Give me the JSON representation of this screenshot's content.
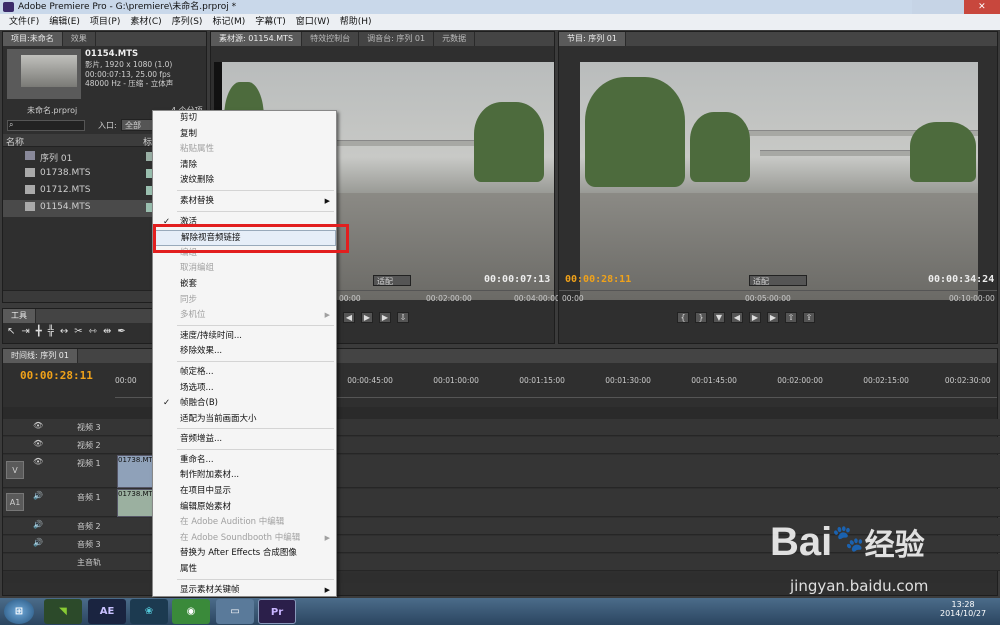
{
  "window": {
    "title": "Adobe Premiere Pro - G:\\premiere\\未命名.prproj *"
  },
  "menubar": [
    "文件(F)",
    "编辑(E)",
    "项目(P)",
    "素材(C)",
    "序列(S)",
    "标记(M)",
    "字幕(T)",
    "窗口(W)",
    "帮助(H)"
  ],
  "project": {
    "tabs": [
      "项目:未命名",
      "效果"
    ],
    "clip_name": "01154.MTS",
    "clip_info": [
      "影片, 1920 x 1080 (1.0)",
      "00:00:07:13, 25.00 fps",
      "48000 Hz - 压缩 - 立体声"
    ],
    "file": "未命名.prproj",
    "count": "4 个分项",
    "in_label": "入口:",
    "in_value": "全部",
    "col_name": "名称",
    "col_label": "标签",
    "items": [
      "序列 01",
      "01738.MTS",
      "01712.MTS",
      "01154.MTS"
    ]
  },
  "source": {
    "tabs": [
      "素材源: 01154.MTS",
      "特效控制台",
      "调音台: 序列 01",
      "元数据"
    ],
    "fit": "适配",
    "timecode": "00:00:07:13",
    "ruler": [
      "00:00",
      "00:02:00:00",
      "00:04:00:00"
    ]
  },
  "program": {
    "tab": "节目: 序列 01",
    "timecode_left": "00:00:28:11",
    "fit": "适配",
    "timecode_right": "00:00:34:24",
    "ruler": [
      "00:00",
      "00:05:00:00",
      "00:10:00:00"
    ]
  },
  "tools": {
    "tab": "工具"
  },
  "timeline": {
    "tab": "时间线: 序列 01",
    "timecode": "00:00:28:11",
    "ruler": [
      "00:00",
      "00:00:45:00",
      "00:01:00:00",
      "00:01:15:00",
      "00:01:30:00",
      "00:01:45:00",
      "00:02:00:00",
      "00:02:15:00",
      "00:02:30:00"
    ],
    "tracks": {
      "v3": "视频 3",
      "v2": "视频 2",
      "v1": "视频 1",
      "a1": "音频 1",
      "a2": "音频 2",
      "a3": "音频 3",
      "master": "主音轨",
      "v_badge": "V",
      "a_badge": "A1"
    },
    "clip_v": "01738.MTS",
    "clip_a": "01738.MTS"
  },
  "context_menu": {
    "items": [
      {
        "label": "剪切",
        "enabled": true
      },
      {
        "label": "复制",
        "enabled": true
      },
      {
        "label": "粘贴属性",
        "enabled": false
      },
      {
        "label": "清除",
        "enabled": true
      },
      {
        "label": "波纹删除",
        "enabled": true
      },
      {
        "sep": true
      },
      {
        "label": "素材替换",
        "enabled": true,
        "submenu": true
      },
      {
        "sep": true
      },
      {
        "label": "激活",
        "enabled": true,
        "checked": true
      },
      {
        "label": "解除视音频链接",
        "enabled": true,
        "highlighted": true
      },
      {
        "label": "编组",
        "enabled": false
      },
      {
        "label": "取消编组",
        "enabled": false
      },
      {
        "label": "嵌套",
        "enabled": true
      },
      {
        "label": "同步",
        "enabled": false
      },
      {
        "label": "多机位",
        "enabled": false,
        "submenu": true
      },
      {
        "sep": true
      },
      {
        "label": "速度/持续时间...",
        "enabled": true
      },
      {
        "label": "移除效果...",
        "enabled": true
      },
      {
        "sep": true
      },
      {
        "label": "帧定格...",
        "enabled": true
      },
      {
        "label": "场选项...",
        "enabled": true
      },
      {
        "label": "帧融合(B)",
        "enabled": true,
        "checked": true
      },
      {
        "label": "适配为当前画面大小",
        "enabled": true
      },
      {
        "sep": true
      },
      {
        "label": "音频增益...",
        "enabled": true
      },
      {
        "sep": true
      },
      {
        "label": "重命名...",
        "enabled": true
      },
      {
        "label": "制作附加素材...",
        "enabled": true
      },
      {
        "label": "在项目中显示",
        "enabled": true
      },
      {
        "label": "编辑原始素材",
        "enabled": true
      },
      {
        "label": "在 Adobe Audition 中编辑",
        "enabled": false
      },
      {
        "label": "在 Adobe Soundbooth 中编辑",
        "enabled": false,
        "submenu": true
      },
      {
        "label": "替换为 After Effects 合成图像",
        "enabled": true
      },
      {
        "label": "属性",
        "enabled": true
      },
      {
        "sep": true
      },
      {
        "label": "显示素材关键帧",
        "enabled": true,
        "submenu": true
      }
    ]
  },
  "taskbar": {
    "apps": [
      "AE",
      "Pr"
    ],
    "time": "13:28",
    "date": "2014/10/27"
  },
  "watermark": {
    "brand": "Bai",
    "brand2": "经验",
    "url": "jingyan.baidu.com"
  }
}
